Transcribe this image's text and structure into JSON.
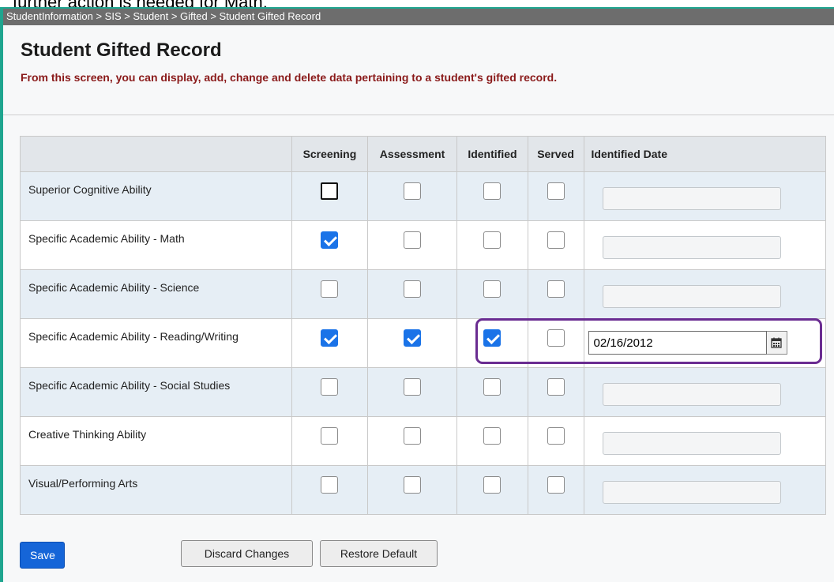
{
  "caption": "further action is needed for Math.",
  "breadcrumb": "StudentInformation > SIS > Student > Gifted > Student Gifted Record",
  "page": {
    "title": "Student Gifted Record",
    "subtitle": "From this screen, you can display, add, change and delete data pertaining to a student's gifted record."
  },
  "table": {
    "columns": [
      "",
      "Screening",
      "Assessment",
      "Identified",
      "Served",
      "Identified Date"
    ],
    "rows": [
      {
        "label": "Superior Cognitive Ability",
        "screening": false,
        "assessment": false,
        "identified": false,
        "served": false,
        "date": ""
      },
      {
        "label": "Specific Academic Ability - Math",
        "screening": true,
        "assessment": false,
        "identified": false,
        "served": false,
        "date": ""
      },
      {
        "label": "Specific Academic Ability - Science",
        "screening": false,
        "assessment": false,
        "identified": false,
        "served": false,
        "date": ""
      },
      {
        "label": "Specific Academic Ability - Reading/Writing",
        "screening": true,
        "assessment": true,
        "identified": true,
        "served": false,
        "date": "02/16/2012"
      },
      {
        "label": "Specific Academic Ability - Social Studies",
        "screening": false,
        "assessment": false,
        "identified": false,
        "served": false,
        "date": ""
      },
      {
        "label": "Creative Thinking Ability",
        "screening": false,
        "assessment": false,
        "identified": false,
        "served": false,
        "date": ""
      },
      {
        "label": "Visual/Performing Arts",
        "screening": false,
        "assessment": false,
        "identified": false,
        "served": false,
        "date": ""
      }
    ]
  },
  "buttons": {
    "save": "Save",
    "discard": "Discard Changes",
    "restore": "Restore Default"
  },
  "icons": {
    "calendar": "calendar-icon"
  },
  "colors": {
    "frame_border": "#1fa58f",
    "highlight": "#6a2c91",
    "checkbox_on": "#1a73e8",
    "save_button": "#1565d8",
    "subtitle": "#8a1a1a"
  }
}
